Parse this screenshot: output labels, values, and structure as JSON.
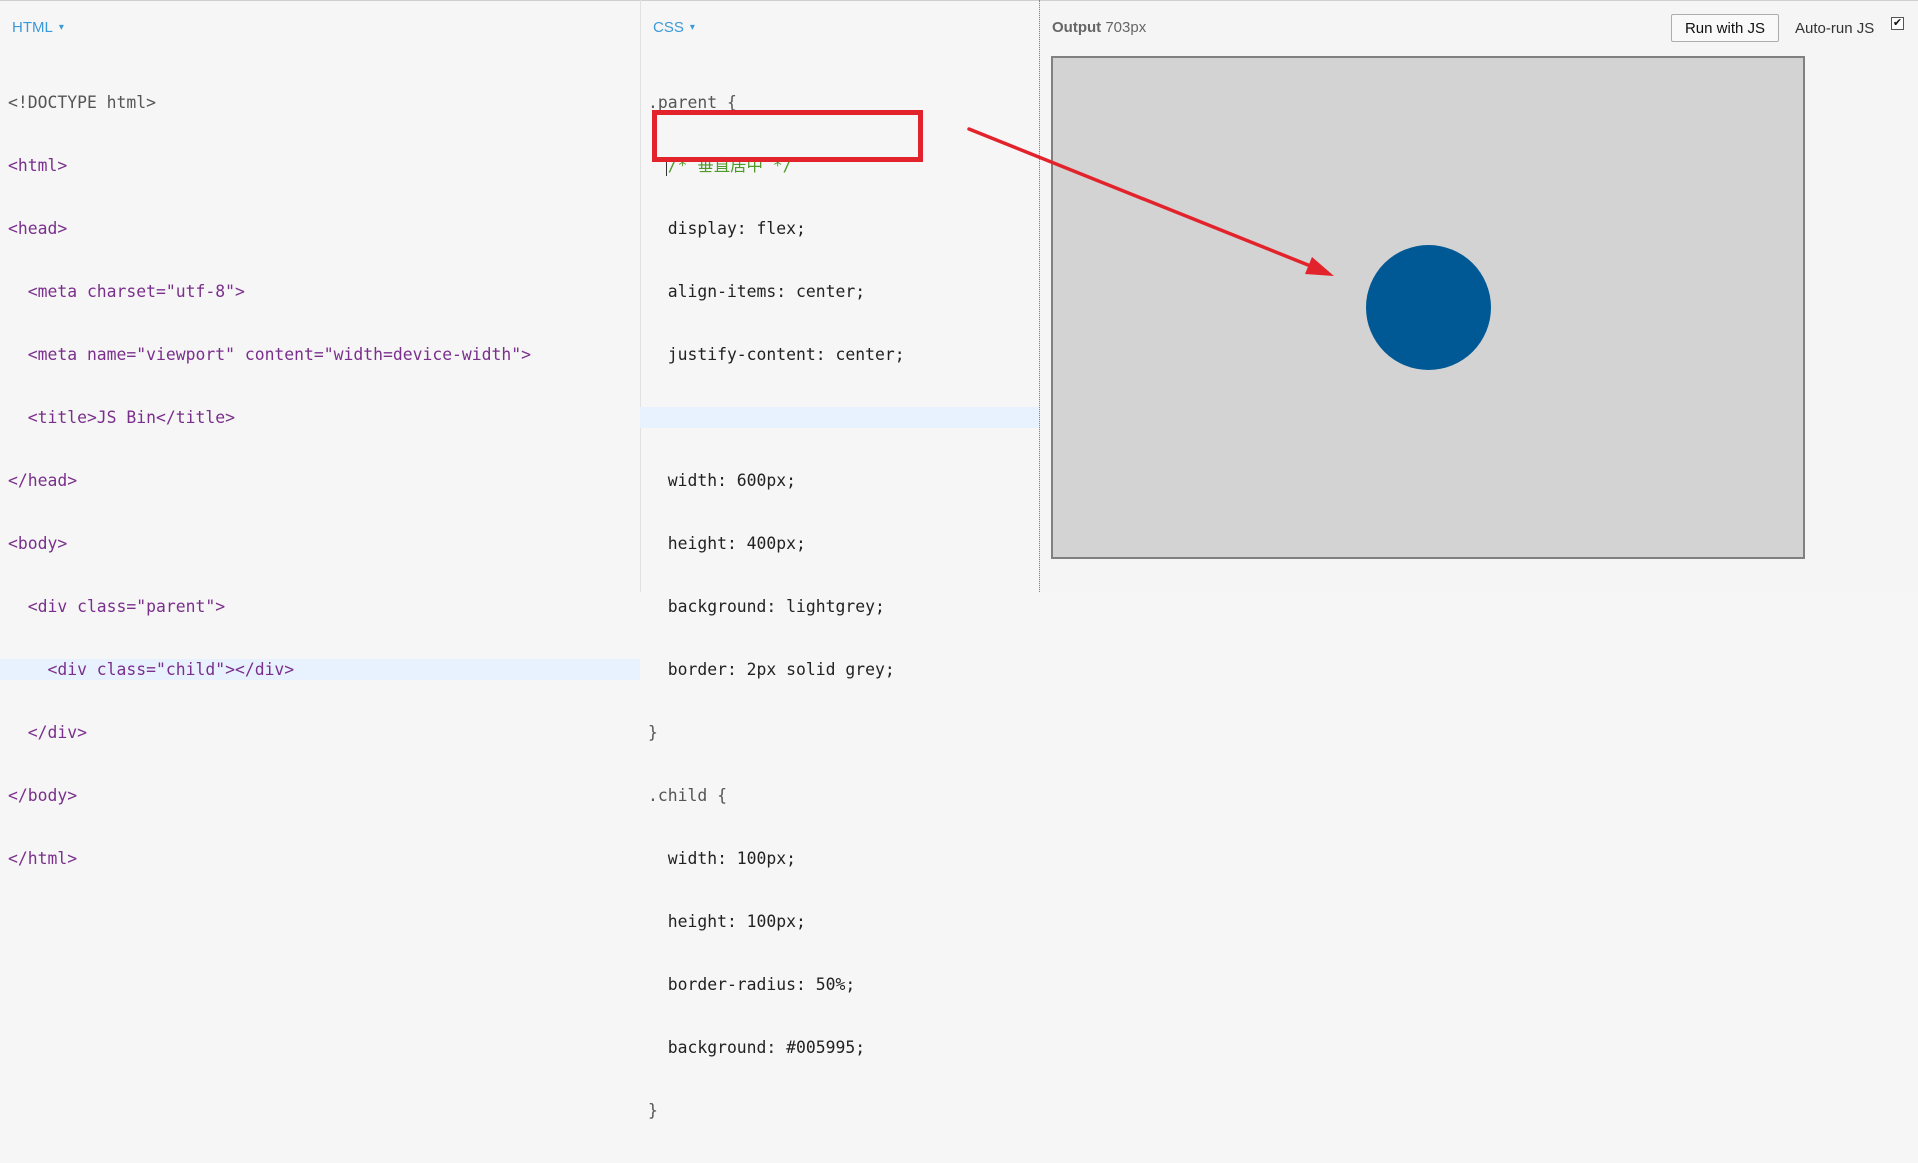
{
  "html_panel": {
    "label": "HTML",
    "caret": "▾",
    "lines": [
      "<!DOCTYPE html>",
      "<html>",
      "<head>",
      "  <meta charset=\"utf-8\">",
      "  <meta name=\"viewport\" content=\"width=device-width\">",
      "  <title>JS Bin</title>",
      "</head>",
      "<body>",
      "  <div class=\"parent\">",
      "    <div class=\"child\"></div>",
      "  </div>",
      "</body>",
      "</html>"
    ]
  },
  "css_panel": {
    "label": "CSS",
    "caret": "▾",
    "lines": [
      ".parent {",
      "  /* 垂直居中 */",
      "  display: flex;",
      "  align-items: center;",
      "  justify-content: center;",
      "  ",
      "  width: 600px;",
      "  height: 400px;",
      "  background: lightgrey;",
      "  border: 2px solid grey;",
      "}",
      ".child {",
      "  width: 100px;",
      "  height: 100px;",
      "  border-radius: 50%;",
      "  background: #005995;",
      "}"
    ]
  },
  "output_panel": {
    "label_bold": "Output",
    "width_text": "703px",
    "run_button": "Run with JS",
    "autorun_label": "Auto-run JS",
    "autorun_checked": true,
    "autorun_mark": "✔",
    "parent_background": "#d3d3d3",
    "parent_border": "#808080",
    "child_color": "#005995"
  },
  "annotation": {
    "color": "#e3232c"
  }
}
